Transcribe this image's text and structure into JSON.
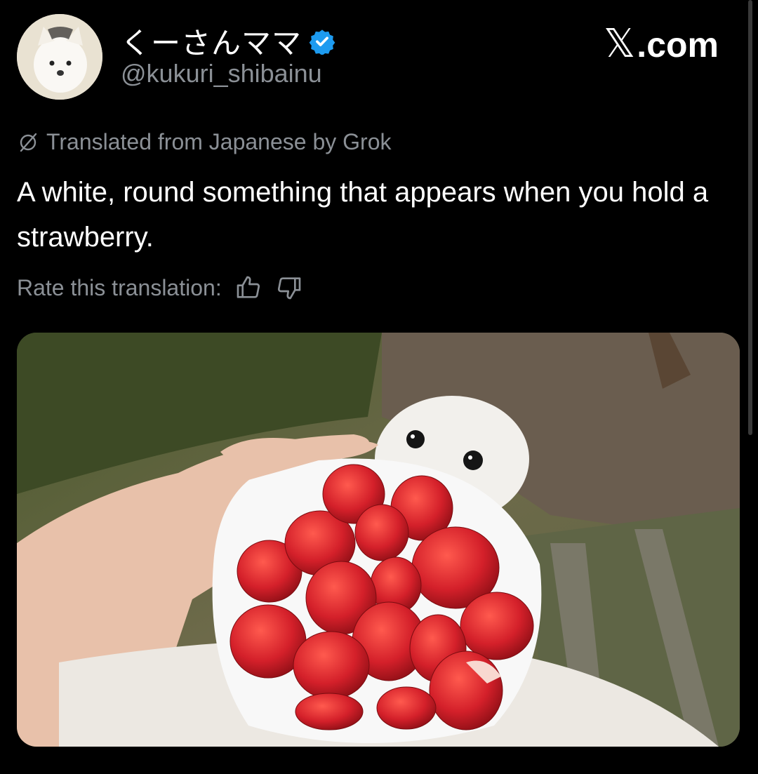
{
  "post": {
    "display_name": "くーさんママ",
    "handle": "@kukuri_shibainu",
    "verified": true,
    "avatar_icon": "dog-avatar-icon",
    "brand_logo": "x-logo-icon",
    "brand_x": "𝕏",
    "brand_suffix": ".com",
    "translation_notice": "Translated from Japanese by Grok",
    "text": "A white, round something that appears when you hold a strawberry.",
    "rate_label": "Rate this translation:",
    "rate_up_icon": "thumbs-up-icon",
    "rate_down_icon": "thumbs-down-icon",
    "media_description_icon": "photo-strawberries-dog"
  },
  "colors": {
    "background": "#000000",
    "primary_text": "#ffffff",
    "secondary_text": "#8b9096",
    "verified_blue": "#1d9bf0",
    "strawberry_red": "#d4202a"
  }
}
